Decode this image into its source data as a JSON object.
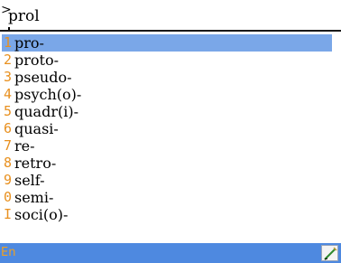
{
  "input": {
    "prompt_glyph": ">",
    "text": "prol"
  },
  "list": {
    "selected_index": 0,
    "items": [
      {
        "key": "1",
        "word": "pro-"
      },
      {
        "key": "2",
        "word": "proto-"
      },
      {
        "key": "3",
        "word": "pseudo-"
      },
      {
        "key": "4",
        "word": "psych(o)-"
      },
      {
        "key": "5",
        "word": "quadr(i)-"
      },
      {
        "key": "6",
        "word": "quasi-"
      },
      {
        "key": "7",
        "word": "re-"
      },
      {
        "key": "8",
        "word": "retro-"
      },
      {
        "key": "9",
        "word": "self-"
      },
      {
        "key": "0",
        "word": "semi-"
      },
      {
        "key": "I",
        "word": "soci(o)-"
      }
    ]
  },
  "status_bar": {
    "language": "En",
    "edit_icon": "pencil-icon"
  },
  "colors": {
    "selection": "#7aa7e8",
    "status_bar": "#4e89e0",
    "hotkey": "#e8901f",
    "language_text": "#f0a020"
  }
}
